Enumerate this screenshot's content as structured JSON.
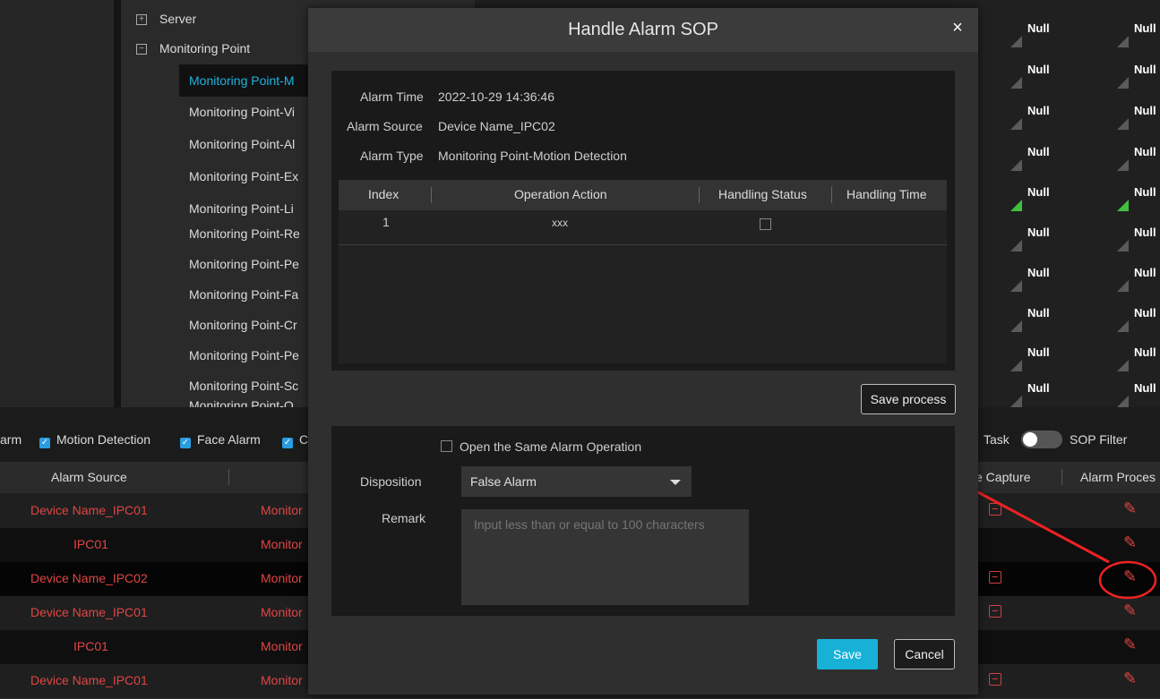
{
  "tree": {
    "nodes": [
      {
        "label": "Server",
        "toggle": "+"
      },
      {
        "label": "Monitoring Point",
        "toggle": "−"
      },
      {
        "label": "Monitoring Point-M",
        "selected": true
      },
      {
        "label": "Monitoring Point-Vi"
      },
      {
        "label": "Monitoring Point-Al"
      },
      {
        "label": "Monitoring Point-Ex"
      },
      {
        "label": "Monitoring Point-Li"
      },
      {
        "label": "Monitoring Point-Re"
      },
      {
        "label": "Monitoring Point-Pe"
      },
      {
        "label": "Monitoring Point-Fa"
      },
      {
        "label": "Monitoring Point-Cr"
      },
      {
        "label": "Monitoring Point-Pe"
      },
      {
        "label": "Monitoring Point-Sc"
      },
      {
        "label": "Monitoring Point-O"
      }
    ]
  },
  "right_grid": {
    "value": "Null"
  },
  "filter_bar": {
    "partial_label": "arm",
    "motion": "Motion Detection",
    "face": "Face Alarm",
    "partial_c": "C",
    "task": "Task",
    "sop_filter": "SOP Filter",
    "sop_filter_on": false
  },
  "table": {
    "headers": {
      "alarm_source": "Alarm Source",
      "face_capture": "ce Capture",
      "alarm_process": "Alarm Proces"
    },
    "rows": [
      {
        "source": "Device Name_IPC01",
        "type": "Monitor"
      },
      {
        "source": "IPC01",
        "type": "Monitor"
      },
      {
        "source": "Device Name_IPC02",
        "type": "Monitor"
      },
      {
        "source": "Device Name_IPC01",
        "type": "Monitor"
      },
      {
        "source": "IPC01",
        "type": "Monitor"
      },
      {
        "source": "Device Name_IPC01",
        "type": "Monitor"
      }
    ]
  },
  "modal": {
    "title": "Handle Alarm SOP",
    "close": "×",
    "alarm_time_label": "Alarm Time",
    "alarm_time": "2022-10-29 14:36:46",
    "alarm_source_label": "Alarm Source",
    "alarm_source": "Device Name_IPC02",
    "alarm_type_label": "Alarm Type",
    "alarm_type": "Monitoring Point-Motion Detection",
    "ops_table": {
      "headers": [
        "Index",
        "Operation Action",
        "Handling Status",
        "Handling Time"
      ],
      "rows": [
        {
          "index": "1",
          "action": "xxx",
          "status": false,
          "time": ""
        }
      ]
    },
    "save_process": "Save process",
    "same_alarm_label": "Open the Same Alarm Operation",
    "same_alarm_checked": false,
    "disposition_label": "Disposition",
    "disposition_value": "False Alarm",
    "remark_label": "Remark",
    "remark_placeholder": "Input less than or equal to 100 characters",
    "save": "Save",
    "cancel": "Cancel"
  },
  "colors": {
    "accent": "#17b1d8",
    "alert": "#e04545",
    "annotation": "#ee2222"
  }
}
